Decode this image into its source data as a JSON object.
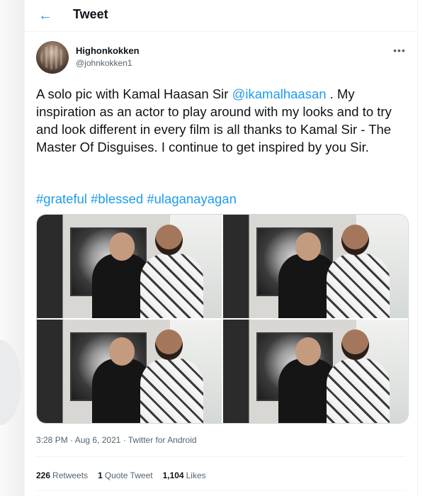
{
  "header": {
    "title": "Tweet",
    "back_icon": "arrow-left-icon"
  },
  "author": {
    "name": "Highonkokken",
    "handle": "@johnkokken1"
  },
  "tweet": {
    "text_part1": "A solo pic with Kamal Haasan Sir ",
    "mention": "@ikamalhaasan",
    "text_part2": " . My inspiration as an actor to play around with my looks and to try and look different in every film is all thanks to Kamal Sir - The Master Of Disguises. I continue to get inspired by you Sir.",
    "hashtags": [
      "#grateful",
      "#blessed",
      "#ulaganayagan"
    ],
    "photo_count": 4
  },
  "meta": {
    "timestamp": "3:28 PM · Aug 6, 2021 · Twitter for Android"
  },
  "stats": {
    "retweets_count": "226",
    "retweets_label": "Retweets",
    "quotes_count": "1",
    "quotes_label": "Quote Tweet",
    "likes_count": "1,104",
    "likes_label": "Likes"
  },
  "colors": {
    "accent": "#1d9bf0",
    "text_primary": "#0f1419",
    "text_secondary": "#536471",
    "divider": "#eff3f4"
  }
}
